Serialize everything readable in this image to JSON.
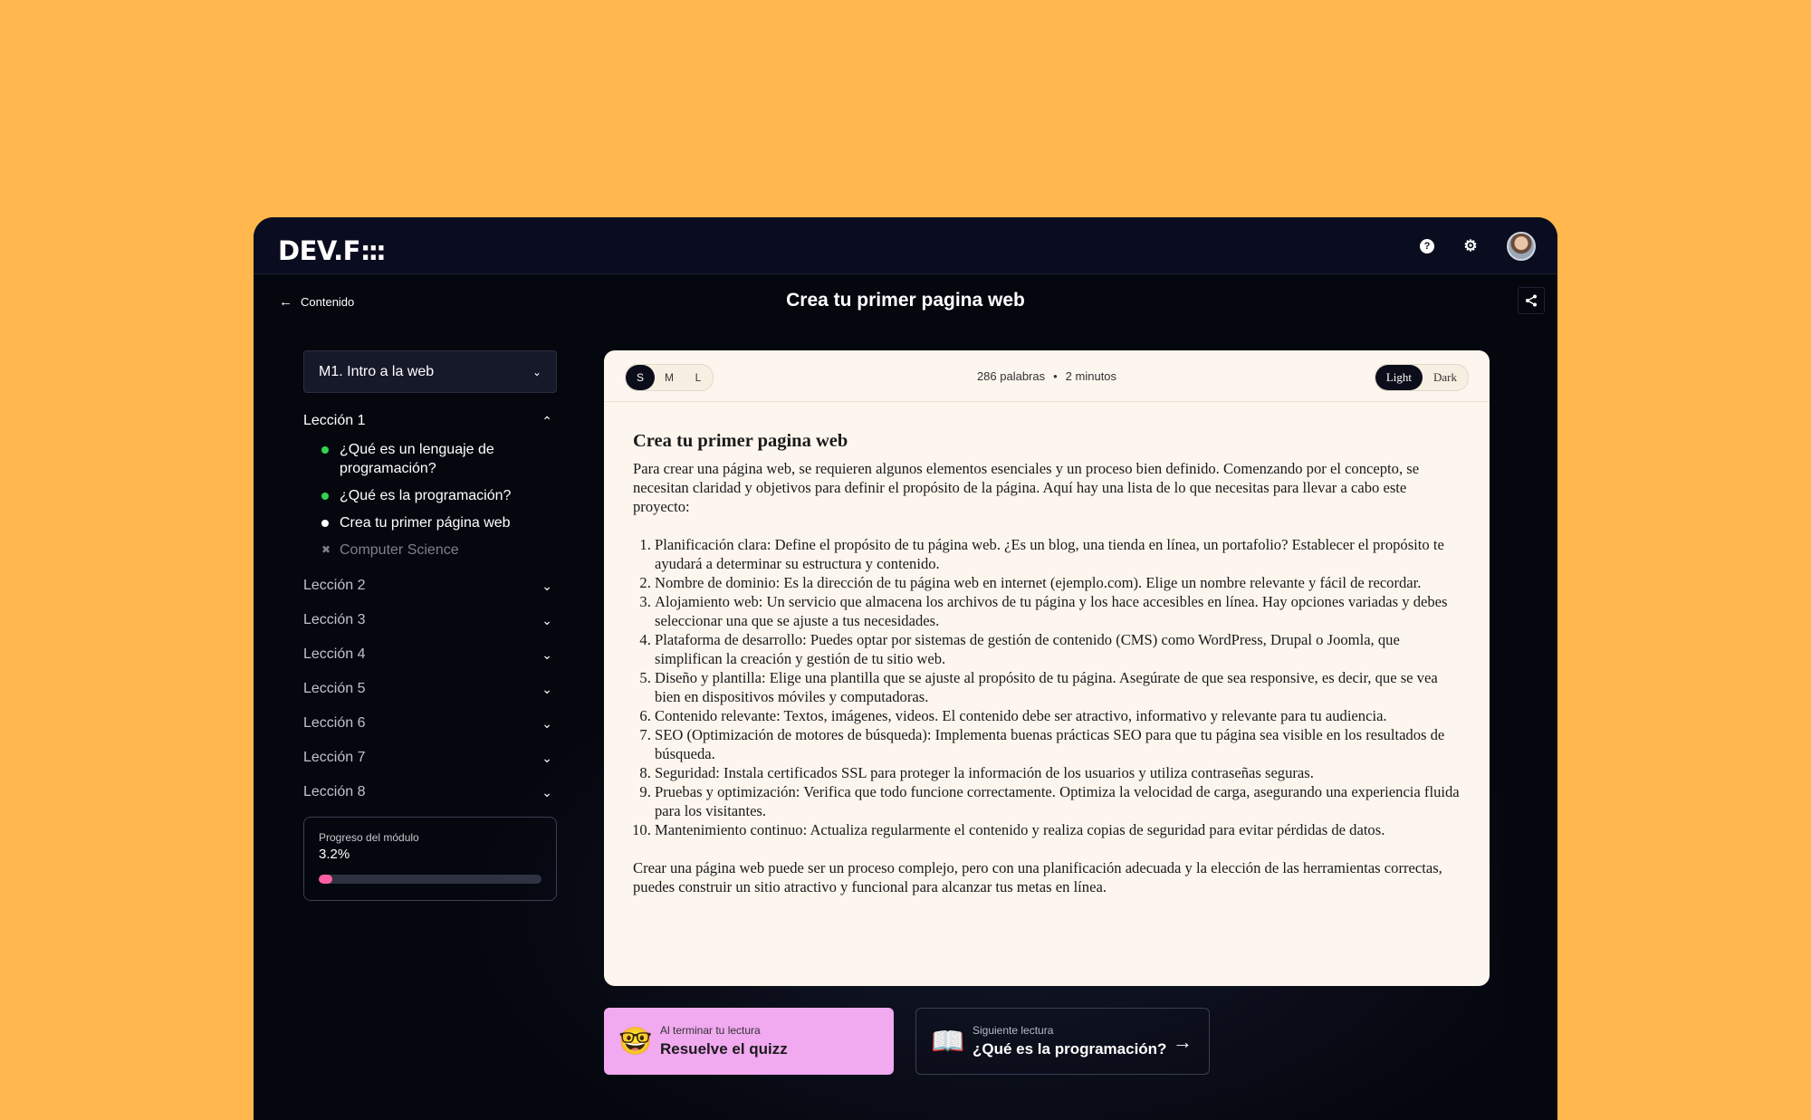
{
  "app": {
    "logo": "DEV.F",
    "logo_dots": ":::"
  },
  "topbar": {
    "help_icon": "?",
    "settings_icon": "⚙"
  },
  "subheader": {
    "back_label": "Contenido",
    "title": "Crea tu primer pagina web"
  },
  "sidebar": {
    "module_select": "M1. Intro a la web",
    "open_lesson": {
      "label": "Lección 1",
      "items": [
        {
          "label": "¿Qué es un lenguaje de programación?",
          "status": "completed"
        },
        {
          "label": "¿Qué es la programación?",
          "status": "completed"
        },
        {
          "label": "Crea tu primer página web",
          "status": "current"
        },
        {
          "label": "Computer Science",
          "status": "locked"
        }
      ]
    },
    "lessons": [
      "Lección 2",
      "Lección 3",
      "Lección 4",
      "Lección 5",
      "Lección 6",
      "Lección 7",
      "Lección 8"
    ],
    "progress": {
      "label": "Progreso del módulo",
      "value_text": "3.2%",
      "fraction": 0.032
    }
  },
  "reader": {
    "sizes": [
      "S",
      "M",
      "L"
    ],
    "active_size": "S",
    "words": "286 palabras",
    "time": "2 minutos",
    "themes": [
      "Light",
      "Dark"
    ],
    "active_theme": "Light",
    "heading": "Crea tu primer pagina web",
    "intro": "Para crear una página web, se requieren algunos elementos esenciales y un proceso bien definido. Comenzando por el concepto, se necesitan claridad y objetivos para definir el propósito de la página. Aquí hay una lista de lo que necesitas para llevar a cabo este proyecto:",
    "list": [
      "Planificación clara: Define el propósito de tu página web. ¿Es un blog, una tienda en línea, un portafolio? Establecer el propósito te ayudará a determinar su estructura y contenido.",
      "Nombre de dominio: Es la dirección de tu página web en internet (ejemplo.com). Elige un nombre relevante y fácil de recordar.",
      "Alojamiento web: Un servicio que almacena los archivos de tu página y los hace accesibles en línea. Hay opciones variadas y debes seleccionar una que se ajuste a tus necesidades.",
      "Plataforma de desarrollo: Puedes optar por sistemas de gestión de contenido (CMS) como WordPress, Drupal o Joomla, que simplifican la creación y gestión de tu sitio web.",
      "Diseño y plantilla: Elige una plantilla que se ajuste al propósito de tu página. Asegúrate de que sea responsive, es decir, que se vea bien en dispositivos móviles y computadoras.",
      "Contenido relevante: Textos, imágenes, videos. El contenido debe ser atractivo, informativo y relevante para tu audiencia.",
      "SEO (Optimización de motores de búsqueda): Implementa buenas prácticas SEO para que tu página sea visible en los resultados de búsqueda.",
      "Seguridad: Instala certificados SSL para proteger la información de los usuarios y utiliza contraseñas seguras.",
      "Pruebas y optimización: Verifica que todo funcione correctamente. Optimiza la velocidad de carga, asegurando una experiencia fluida para los visitantes.",
      "Mantenimiento continuo: Actualiza regularmente el contenido y realiza copias de seguridad para evitar pérdidas de datos."
    ],
    "outro": "Crear una página web puede ser un proceso complejo, pero con una planificación adecuada y la elección de las herramientas correctas, puedes construir un sitio atractivo y funcional para alcanzar tus metas en línea."
  },
  "cards": {
    "quiz": {
      "emoji": "🤓",
      "sub": "Al terminar tu lectura",
      "main": "Resuelve el quizz"
    },
    "next": {
      "emoji": "📖",
      "sub": "Siguiente lectura",
      "main": "¿Qué es la programación?"
    }
  },
  "colors": {
    "background": "#FFB74E",
    "accent_pink": "#F1A9F0",
    "progress": "#FF5FA2",
    "complete": "#2FD64F"
  }
}
